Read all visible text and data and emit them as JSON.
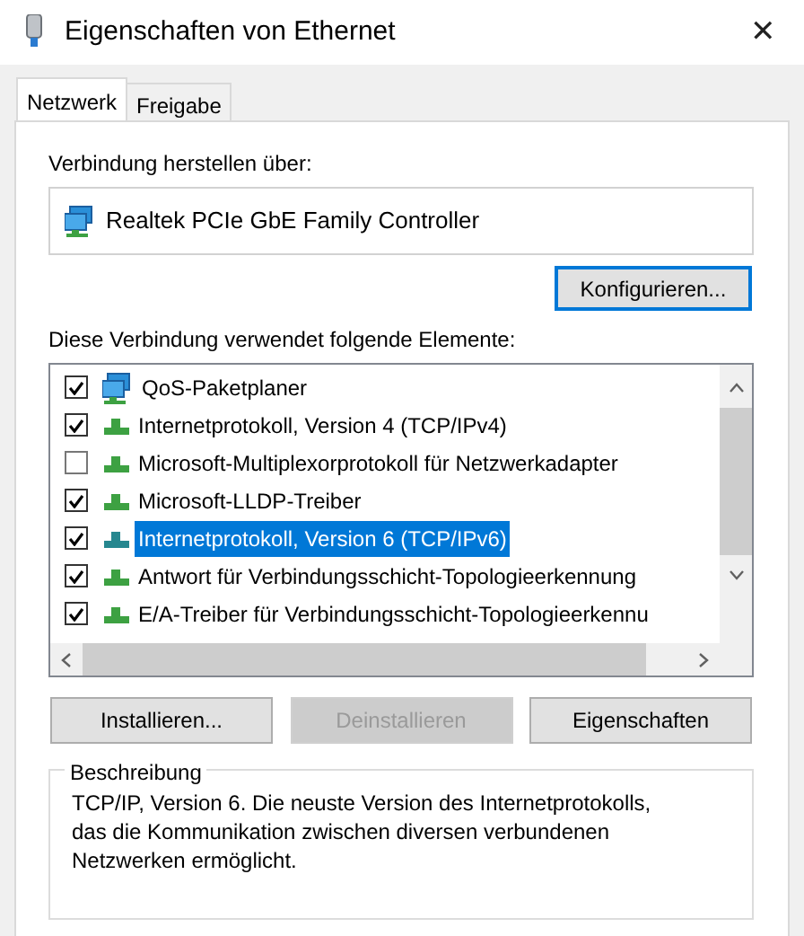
{
  "window": {
    "title": "Eigenschaften von Ethernet",
    "close": "✕"
  },
  "tabs": [
    {
      "label": "Netzwerk",
      "selected": true
    },
    {
      "label": "Freigabe",
      "selected": false
    }
  ],
  "connect_via": {
    "label": "Verbindung herstellen über:",
    "adapter": "Realtek PCIe GbE Family Controller",
    "button": "Konfigurieren..."
  },
  "elements": {
    "label": "Diese Verbindung verwendet folgende Elemente:",
    "items": [
      {
        "label": "QoS-Paketplaner",
        "kind": "service",
        "checked": true,
        "selected": false
      },
      {
        "label": "Internetprotokoll, Version 4 (TCP/IPv4)",
        "kind": "protocol",
        "checked": true,
        "selected": false
      },
      {
        "label": "Microsoft-Multiplexorprotokoll für Netzwerkadapter",
        "kind": "protocol",
        "checked": false,
        "selected": false
      },
      {
        "label": "Microsoft-LLDP-Treiber",
        "kind": "protocol",
        "checked": true,
        "selected": false
      },
      {
        "label": "Internetprotokoll, Version 6 (TCP/IPv6)",
        "kind": "protocol",
        "checked": true,
        "selected": true
      },
      {
        "label": "Antwort für Verbindungsschicht-Topologieerkennung",
        "kind": "protocol",
        "checked": true,
        "selected": false
      },
      {
        "label": "E/A-Treiber für Verbindungsschicht-Topologieerkennu",
        "kind": "protocol",
        "checked": true,
        "selected": false
      }
    ]
  },
  "buttons": [
    {
      "label": "Installieren...",
      "disabled": false
    },
    {
      "label": "Deinstallieren",
      "disabled": true
    },
    {
      "label": "Eigenschaften",
      "disabled": false
    }
  ],
  "description": {
    "legend": "Beschreibung",
    "text": "TCP/IP, Version 6. Die neuste Version des Internetprotokolls, das die Kommunikation zwischen diversen verbundenen Netzwerken ermöglicht."
  }
}
